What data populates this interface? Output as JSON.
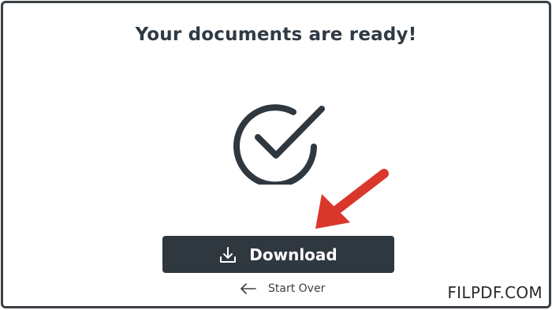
{
  "dialog": {
    "title": "Your documents are ready!",
    "status_icon": "check-circle-icon",
    "pointer_icon": "red-arrow-icon"
  },
  "actions": {
    "download_label": "Download",
    "download_icon": "download-icon",
    "start_over_label": "Start Over",
    "start_over_icon": "arrow-left-icon"
  },
  "watermark": "FILPDF.COM",
  "colors": {
    "frame": "#3b4045",
    "button_bg": "#2f373f",
    "arrow": "#d9372b",
    "text": "#2f3a44"
  }
}
